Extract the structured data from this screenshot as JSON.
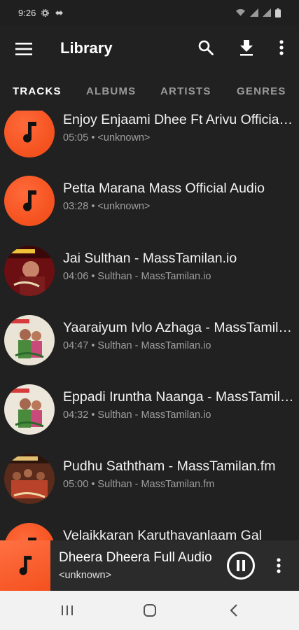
{
  "status": {
    "time": "9:26"
  },
  "app_bar": {
    "title": "Library"
  },
  "tabs": [
    {
      "label": "TRACKS",
      "active": true
    },
    {
      "label": "ALBUMS",
      "active": false
    },
    {
      "label": "ARTISTS",
      "active": false
    },
    {
      "label": "GENRES",
      "active": false
    }
  ],
  "tracks": [
    {
      "title": "Enjoy Enjaami Dhee Ft Arivu Official Video",
      "subtitle": "05:05 • <unknown>",
      "art": "music-note"
    },
    {
      "title": "Petta Marana Mass Official Audio",
      "subtitle": "03:28 • <unknown>",
      "art": "music-note"
    },
    {
      "title": "Jai Sulthan - MassTamilan.io",
      "subtitle": "04:06 • Sulthan - MassTamilan.io",
      "art": "album-cover-red"
    },
    {
      "title": "Yaaraiyum Ivlo Azhaga - MassTamilan.io",
      "subtitle": "04:47 • Sulthan - MassTamilan.io",
      "art": "album-cover-light"
    },
    {
      "title": "Eppadi Iruntha Naanga - MassTamilan.io",
      "subtitle": "04:32 • Sulthan - MassTamilan.io",
      "art": "album-cover-light"
    },
    {
      "title": "Pudhu Saththam - MassTamilan.fm",
      "subtitle": "05:00 • Sulthan - MassTamilan.fm",
      "art": "album-cover-group"
    },
    {
      "title": "Velaikkaran Karuthavanlaam Gal",
      "subtitle": "",
      "art": "music-note"
    }
  ],
  "now_playing": {
    "title": "Dheera Dheera Full Audio",
    "subtitle": "<unknown>",
    "state": "playing"
  },
  "colors": {
    "background": "#212121",
    "accent": "#f4511e",
    "text_secondary": "#9e9e9e",
    "nav_bar": "#f2f2f2"
  }
}
